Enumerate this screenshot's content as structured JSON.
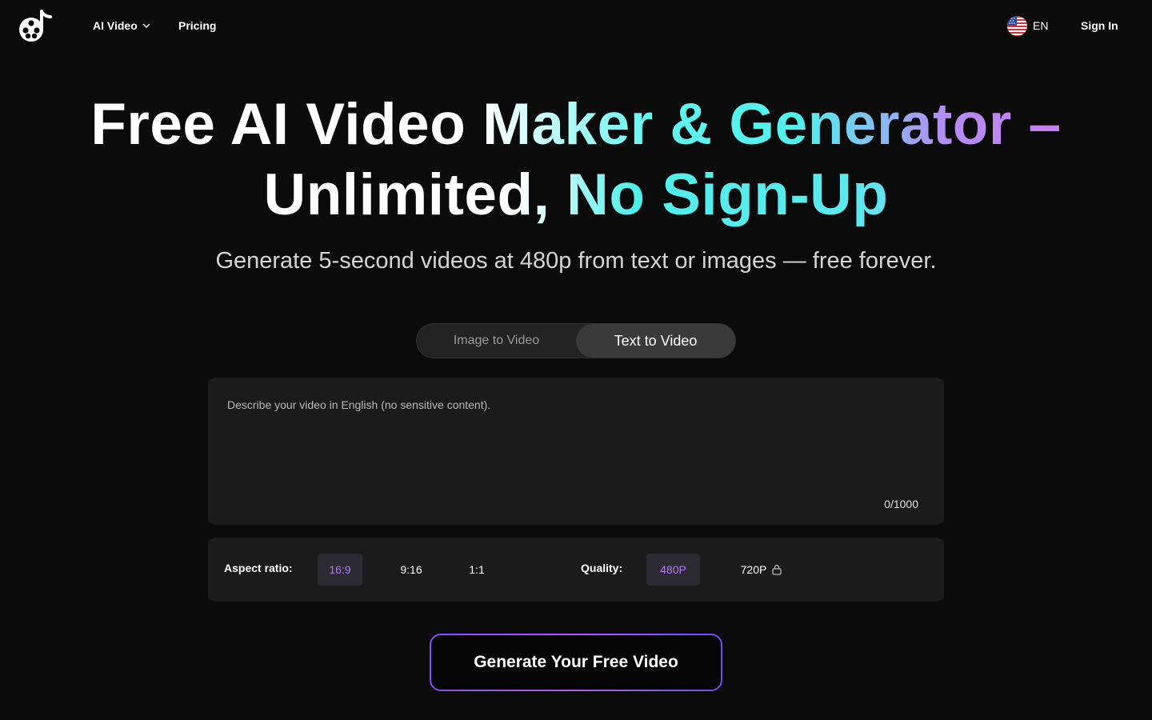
{
  "header": {
    "nav": {
      "ai_video": "AI Video",
      "pricing": "Pricing"
    },
    "language": "EN",
    "sign_in": "Sign In"
  },
  "hero": {
    "title_line1_plain": "Free AI Video ",
    "title_line1_grad": "Maker & Generator –",
    "title_line2": "Unlimited, No Sign-Up",
    "subtitle": "Generate 5-second videos at 480p from text or images — free forever."
  },
  "tabs": [
    {
      "label": "Image to Video",
      "active": false
    },
    {
      "label": "Text to Video",
      "active": true
    }
  ],
  "prompt": {
    "placeholder": "Describe your video in English (no sensitive content).",
    "value": "",
    "counter": "0/1000"
  },
  "options": {
    "aspect_label": "Aspect ratio:",
    "aspect_ratios": [
      {
        "label": "16:9",
        "selected": true
      },
      {
        "label": "9:16",
        "selected": false
      },
      {
        "label": "1:1",
        "selected": false
      }
    ],
    "quality_label": "Quality:",
    "qualities": [
      {
        "label": "480P",
        "selected": true,
        "locked": false
      },
      {
        "label": "720P",
        "selected": false,
        "locked": true
      }
    ]
  },
  "cta": {
    "label": "Generate Your Free Video"
  },
  "colors": {
    "background": "#0b0b0b",
    "panel": "#1b1b1b",
    "accent_purple": "#b57cf2",
    "accent_cyan": "#52f0ec"
  },
  "icons": {
    "logo": "film-reel-music-note-icon",
    "chevron": "chevron-down-icon",
    "flag": "us-flag-icon",
    "lock": "lock-icon"
  }
}
